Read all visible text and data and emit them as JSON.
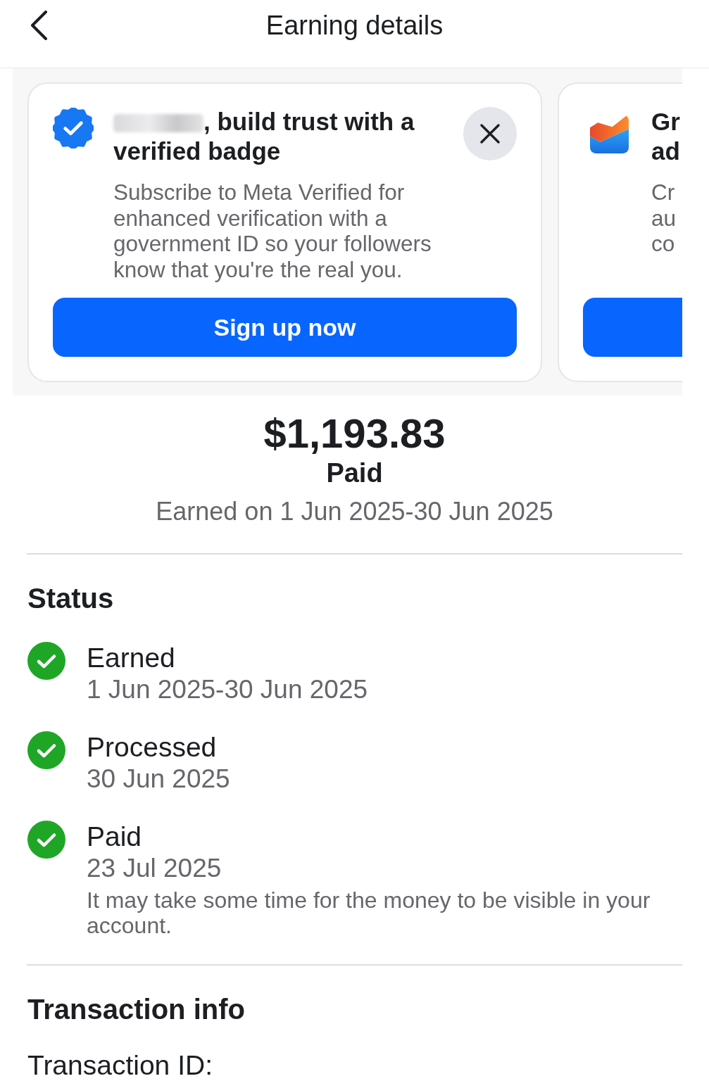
{
  "header": {
    "title": "Earning details"
  },
  "promo_cards": [
    {
      "kind": "verified",
      "redacted_name": true,
      "title": ", build trust with a verified badge",
      "description": "Subscribe to Meta Verified for enhanced verification with a government ID so your followers know that you're the real you.",
      "button": "Sign up now",
      "dismissible": true
    },
    {
      "kind": "growth",
      "title_lines": [
        "Gr",
        "ad"
      ],
      "description_lines": [
        "Cr",
        "au",
        "co"
      ]
    }
  ],
  "summary": {
    "amount": "$1,193.83",
    "status": "Paid",
    "period": "Earned on 1 Jun 2025-30 Jun 2025"
  },
  "status_section": {
    "heading": "Status",
    "items": [
      {
        "label": "Earned",
        "date": "1 Jun 2025-30 Jun 2025",
        "done": true
      },
      {
        "label": "Processed",
        "date": "30 Jun 2025",
        "done": true
      },
      {
        "label": "Paid",
        "date": "23 Jul 2025",
        "note": "It may take some time for the money to be visible in your account.",
        "done": true
      }
    ]
  },
  "transaction_info": {
    "heading": "Transaction info",
    "rows": [
      {
        "label": "Transaction ID:"
      }
    ]
  }
}
